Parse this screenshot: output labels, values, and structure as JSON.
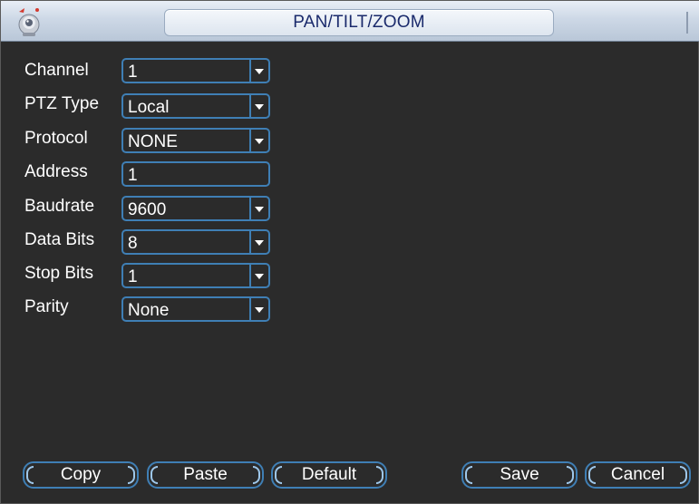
{
  "window": {
    "title": "PAN/TILT/ZOOM",
    "icon": "camera-app-icon"
  },
  "form": {
    "rows": [
      {
        "label": "Channel",
        "value": "1",
        "dropdown": true
      },
      {
        "label": "PTZ Type",
        "value": "Local",
        "dropdown": true
      },
      {
        "label": "Protocol",
        "value": "NONE",
        "dropdown": true
      },
      {
        "label": "Address",
        "value": "1",
        "dropdown": false
      },
      {
        "label": "Baudrate",
        "value": "9600",
        "dropdown": true
      },
      {
        "label": "Data Bits",
        "value": "8",
        "dropdown": true
      },
      {
        "label": "Stop Bits",
        "value": "1",
        "dropdown": true
      },
      {
        "label": "Parity",
        "value": "None",
        "dropdown": true
      }
    ]
  },
  "buttons": {
    "copy": "Copy",
    "paste": "Paste",
    "default": "Default",
    "save": "Save",
    "cancel": "Cancel"
  },
  "colors": {
    "background": "#2b2b2b",
    "field_border": "#3f7fb5",
    "title_text": "#1a2a6c",
    "text": "#ffffff"
  }
}
